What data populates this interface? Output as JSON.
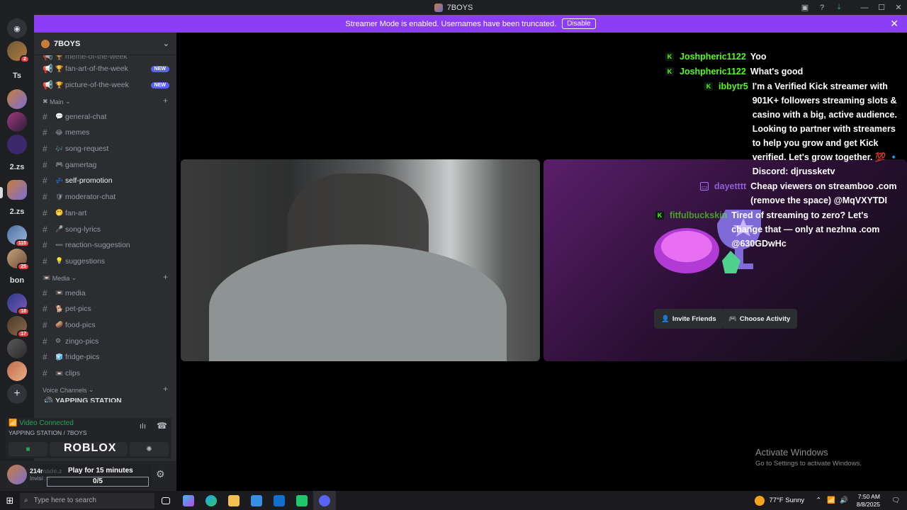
{
  "window": {
    "title": "7BOYS"
  },
  "banner": {
    "text": "Streamer Mode is enabled. Usernames have been truncated.",
    "button": "Disable"
  },
  "servers": [
    {
      "label": "",
      "badge": "2"
    },
    {
      "label": "Ts",
      "badge": ""
    },
    {
      "label": "",
      "badge": ""
    },
    {
      "label": "",
      "badge": ""
    },
    {
      "label": "",
      "badge": ""
    },
    {
      "label": "2.zs",
      "badge": ""
    },
    {
      "label": "",
      "badge": ""
    },
    {
      "label": "2.zs",
      "badge": ""
    },
    {
      "label": "",
      "badge": "115"
    },
    {
      "label": "",
      "badge": "25"
    },
    {
      "label": "bon",
      "badge": ""
    },
    {
      "label": "",
      "badge": "18"
    },
    {
      "label": "",
      "badge": "17"
    }
  ],
  "guild": {
    "name": "7BOYS"
  },
  "channels_top": [
    {
      "name": "fan-art-of-the-week",
      "emoji": "🏆",
      "badge": "NEW"
    },
    {
      "name": "picture-of-the-week",
      "emoji": "🏆",
      "badge": "NEW"
    }
  ],
  "partial_top": "meme-of-the-week",
  "categories": {
    "main": "Main",
    "media": "Media",
    "voice": "Voice Channels"
  },
  "main_channels": [
    {
      "name": "general-chat",
      "emoji": "💬"
    },
    {
      "name": "memes",
      "emoji": "😂"
    },
    {
      "name": "song-request",
      "emoji": "🎶"
    },
    {
      "name": "gamertag",
      "emoji": "🎮"
    },
    {
      "name": "self-promotion",
      "emoji": "💤"
    },
    {
      "name": "moderator-chat",
      "emoji": "🛡"
    },
    {
      "name": "fan-art",
      "emoji": "🤭"
    },
    {
      "name": "song-lyrics",
      "emoji": "🎤"
    },
    {
      "name": "reaction-suggestion",
      "emoji": "➖"
    },
    {
      "name": "suggestions",
      "emoji": "💡"
    }
  ],
  "media_channels": [
    {
      "name": "media",
      "emoji": "📼"
    },
    {
      "name": "pet-pics",
      "emoji": "🐕"
    },
    {
      "name": "food-pics",
      "emoji": "🥔"
    },
    {
      "name": "zingo-pics",
      "emoji": "⚙"
    },
    {
      "name": "fridge-pics",
      "emoji": "🧊"
    },
    {
      "name": "clips",
      "emoji": "📼"
    }
  ],
  "voice_partial": "YAPPING STATION",
  "voice": {
    "status": "Video Connected",
    "location": "YAPPING STATION / 7BOYS"
  },
  "roblox": {
    "logo": "ROBLOX",
    "play_title": "Play for 15 minutes",
    "progress_text": "0/5",
    "progress": 0
  },
  "user": {
    "name": "214made.z",
    "status": "Invisible"
  },
  "chat": [
    {
      "platform": "kick",
      "user": "Joshpheric1122",
      "text": "Yoo"
    },
    {
      "platform": "kick",
      "user": "Joshpheric1122",
      "text": "What's good"
    },
    {
      "platform": "kick",
      "user": "ibbytr5",
      "text": "I'm a Verified Kick streamer with 901K+ followers streaming slots & casino with a big, active audience. Looking to partner with streamers to help you grow and get Kick verified. Let's grow together. 💯 🔹 Discord: djrussketv"
    },
    {
      "platform": "twitch",
      "user": "dayetttt",
      "text": "Cheap viewers on streamboo .com (remove the space) @MqVXYTDI"
    },
    {
      "platform": "kick",
      "user": "fitfulbuckskin",
      "text": "Tired of streaming to zero? Let's change that — only at nezhna .com @630GDwHc"
    }
  ],
  "activity": {
    "invite": "Invite Friends",
    "choose": "Choose Activity"
  },
  "watermark": {
    "title": "Activate Windows",
    "subtitle": "Go to Settings to activate Windows."
  },
  "taskbar": {
    "search_placeholder": "Type here to search",
    "weather": "77°F  Sunny",
    "time": "7:50 AM",
    "date": "8/8/2025"
  },
  "colors": {
    "accent": "#8c3ef7",
    "kick": "#53fc18",
    "voice": "#23a55a",
    "badge": "#f23f43"
  }
}
